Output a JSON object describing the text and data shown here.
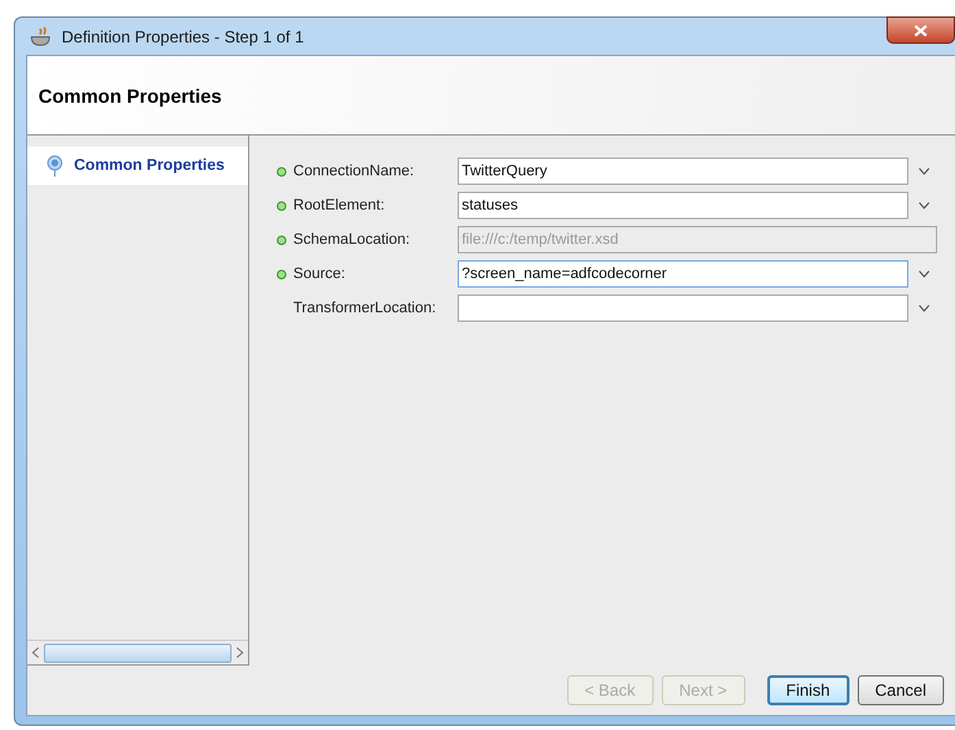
{
  "window": {
    "title": "Definition Properties - Step 1 of 1"
  },
  "header": {
    "title": "Common Properties"
  },
  "sidebar": {
    "items": [
      {
        "label": "Common Properties",
        "selected": true
      }
    ]
  },
  "fields": [
    {
      "label": "ConnectionName:",
      "required": true,
      "kind": "dropdown",
      "value": "TwitterQuery",
      "disabled": false,
      "focused": false
    },
    {
      "label": "RootElement:",
      "required": true,
      "kind": "dropdown",
      "value": "statuses",
      "disabled": false,
      "focused": false
    },
    {
      "label": "SchemaLocation:",
      "required": true,
      "kind": "text",
      "value": "file:///c:/temp/twitter.xsd",
      "disabled": true,
      "focused": false
    },
    {
      "label": "Source:",
      "required": true,
      "kind": "dropdown",
      "value": "?screen_name=adfcodecorner",
      "disabled": false,
      "focused": true
    },
    {
      "label": "TransformerLocation:",
      "required": false,
      "kind": "dropdown",
      "disabled": false,
      "focused": false
    }
  ],
  "buttons": [
    {
      "label": "< Back",
      "disabled": true,
      "default": false
    },
    {
      "label": "Next >",
      "disabled": true,
      "default": false
    },
    {
      "label": "Finish",
      "disabled": false,
      "default": true
    },
    {
      "label": "Cancel",
      "disabled": false,
      "default": false
    }
  ]
}
